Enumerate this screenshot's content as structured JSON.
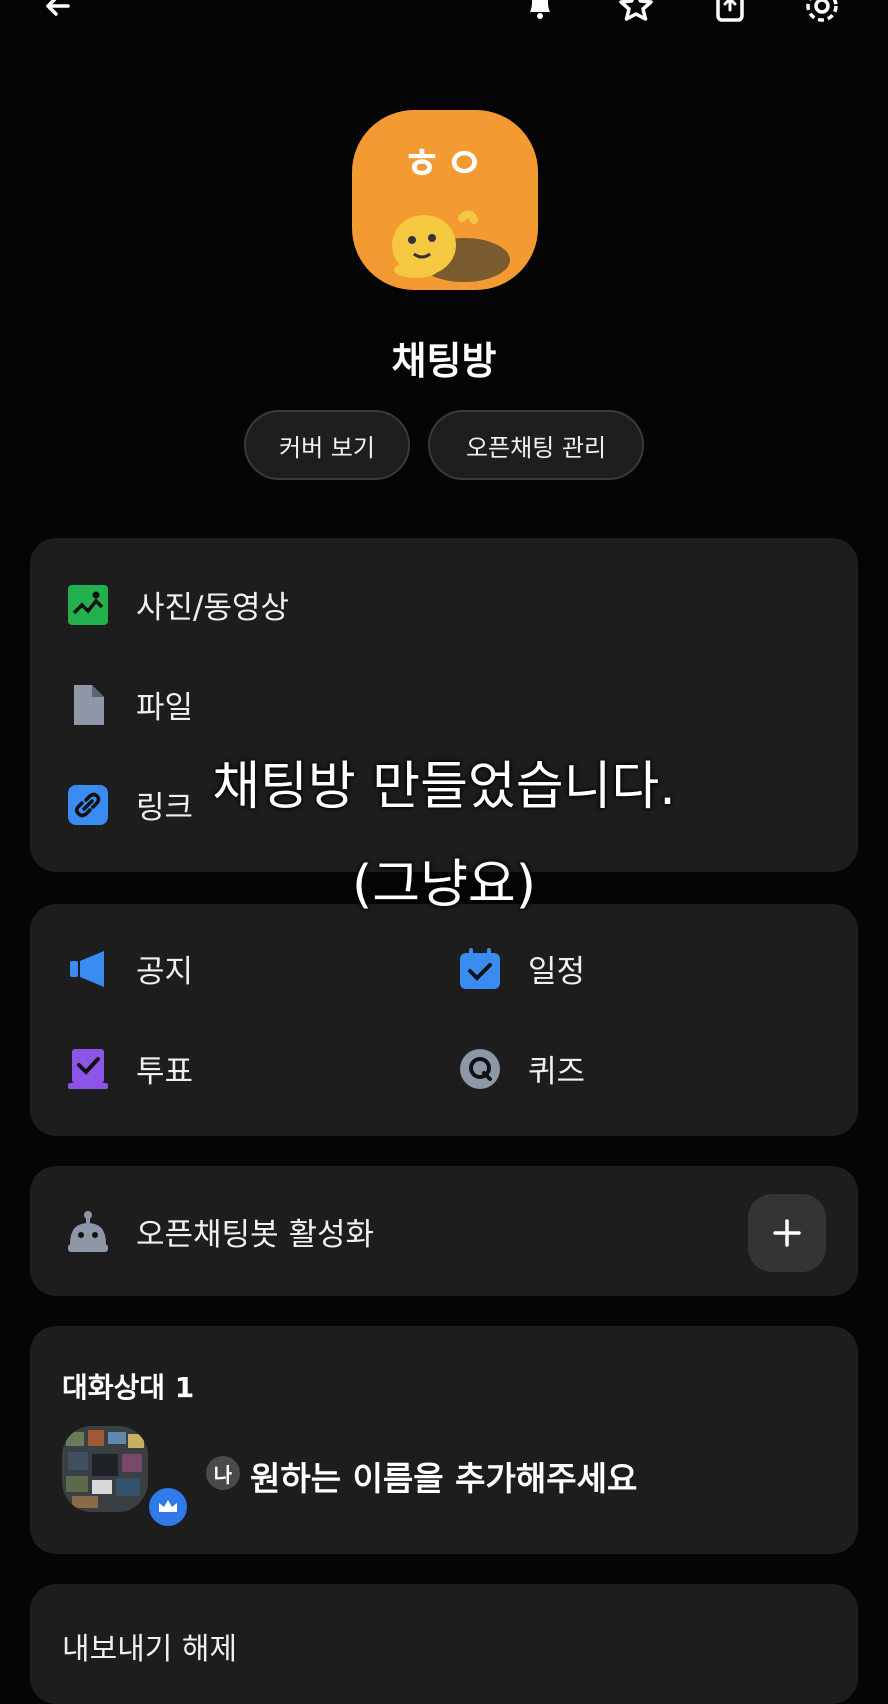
{
  "header": {
    "back_icon": "back-arrow-icon",
    "icons": [
      "bell-icon",
      "star-icon",
      "share-icon",
      "gear-icon"
    ]
  },
  "profile": {
    "image_text": "ㅎㅇ",
    "title": "채팅방",
    "buttons": {
      "cover": "커버 보기",
      "manage": "오픈채팅 관리"
    }
  },
  "media_card": {
    "items": [
      {
        "label": "사진/동영상",
        "icon": "photo-icon",
        "color": "#22b14c"
      },
      {
        "label": "파일",
        "icon": "file-icon",
        "color": "#8e97a8"
      },
      {
        "label": "링크",
        "icon": "link-icon",
        "color": "#3a8cf0"
      }
    ]
  },
  "tools_card": {
    "items": [
      {
        "label": "공지",
        "icon": "megaphone-icon",
        "color": "#3a8cf0"
      },
      {
        "label": "일정",
        "icon": "calendar-icon",
        "color": "#3a8cf0"
      },
      {
        "label": "투표",
        "icon": "vote-icon",
        "color": "#8c55e8"
      },
      {
        "label": "퀴즈",
        "icon": "quiz-icon",
        "color": "#8e97a8"
      }
    ]
  },
  "bot_card": {
    "label": "오픈채팅봇 활성화",
    "icon": "bot-icon"
  },
  "members_card": {
    "title": "대화상대 1",
    "me_badge": "나",
    "member_name": "원하는 이름을 추가해주세요"
  },
  "export_card": {
    "label": "내보내기 해제"
  },
  "overlay": {
    "line1": "채팅방 만들었습니다.",
    "line2": "(그냥요)"
  }
}
